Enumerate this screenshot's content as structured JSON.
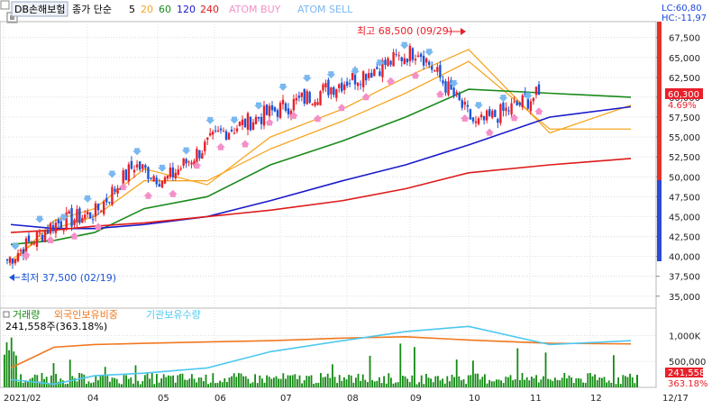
{
  "header": {
    "stock_name": "DB손해보험",
    "ma_label": "종가 단순",
    "ma_periods": [
      "5",
      "20",
      "60",
      "120",
      "240"
    ],
    "atom_buy": "ATOM BUY",
    "atom_sell": "ATOM SELL"
  },
  "corner": {
    "lc": "LC:60,80",
    "hc": "HC:-11,97"
  },
  "price_badge": {
    "value": "60,300",
    "pct": "4.69%"
  },
  "volume_panel": {
    "labels": [
      "거래량",
      "외국인보유비중",
      "기관보유수량"
    ],
    "values": "241,558주(363.18%)",
    "badge_top": "241,558",
    "badge_bottom": "363.18%"
  },
  "annotations": {
    "high": "최고 68,500 (09/29)",
    "low": "최저 37,500 (02/19)"
  },
  "colors": {
    "ma5": "#f5a623",
    "ma20": "#f5a623",
    "ma60": "#1a8a1a",
    "ma120": "#1a1acc",
    "ma240": "#dd1a1a",
    "up_candle": "#e8202a",
    "down_candle": "#1a55d8",
    "atom_buy": "#f48fc8",
    "atom_sell": "#7ab8f0",
    "foreign_ratio": "#f07820",
    "institution": "#4dc8f0",
    "volume": "#148a14"
  },
  "chart_data": [
    {
      "type": "candlestick",
      "title": "DB손해보험",
      "x": [
        "2021/02",
        "04",
        "05",
        "06",
        "07",
        "08",
        "09",
        "10",
        "11",
        "12",
        "12/17"
      ],
      "ylim": [
        33500,
        69500
      ],
      "yticks": [
        "67,500",
        "65,000",
        "62,500",
        "60,000",
        "57,500",
        "55,000",
        "52,500",
        "50,000",
        "47,500",
        "45,000",
        "42,500",
        "40,000",
        "37,500",
        "35,000"
      ],
      "close_monthly": {
        "2021-02": 39500,
        "2021-03": 44000,
        "2021-04": 45500,
        "2021-05": 51500,
        "2021-06": 49500,
        "2021-07": 55500,
        "2021-08": 59000,
        "2021-09": 62500,
        "2021-10": 66000,
        "2021-11": 56500,
        "2021-12-17": 60300
      },
      "high": {
        "value": 68500,
        "date": "09/29"
      },
      "low": {
        "value": 37500,
        "date": "02/19"
      },
      "last_close": 60300,
      "change_pct": 4.69,
      "series": [
        {
          "name": "5",
          "values": [
            39000,
            44500,
            46000,
            51000,
            49000,
            55000,
            58500,
            62500,
            66000,
            55500,
            59000
          ]
        },
        {
          "name": "20",
          "values": [
            39500,
            43500,
            45000,
            49500,
            49500,
            53500,
            57000,
            60500,
            64500,
            56000,
            56000
          ]
        },
        {
          "name": "60",
          "values": [
            41500,
            42000,
            43000,
            46000,
            47500,
            51500,
            54500,
            57500,
            61000,
            60500,
            60000
          ]
        },
        {
          "name": "120",
          "values": [
            44000,
            43500,
            43500,
            44000,
            45000,
            47000,
            49500,
            51500,
            54000,
            57500,
            58800
          ]
        },
        {
          "name": "240",
          "values": [
            43000,
            43300,
            43800,
            44200,
            45000,
            45800,
            47000,
            48500,
            50500,
            51500,
            52300
          ]
        }
      ]
    },
    {
      "type": "bar",
      "title": "거래량",
      "ylim": [
        0,
        1250000
      ],
      "yticks": [
        "1,000K",
        "500,000"
      ],
      "last_volume": 241558,
      "volume_pct": 363.18,
      "series": [
        {
          "name": "외국인보유비중",
          "values": [
            0.3,
            0.62,
            0.66,
            0.68,
            0.7,
            0.72,
            0.76,
            0.78,
            0.73,
            0.68,
            0.67
          ]
        },
        {
          "name": "기관보유수량",
          "values": [
            0.12,
            0.05,
            0.18,
            0.22,
            0.3,
            0.55,
            0.72,
            0.86,
            0.94,
            0.66,
            0.72
          ]
        }
      ]
    }
  ]
}
